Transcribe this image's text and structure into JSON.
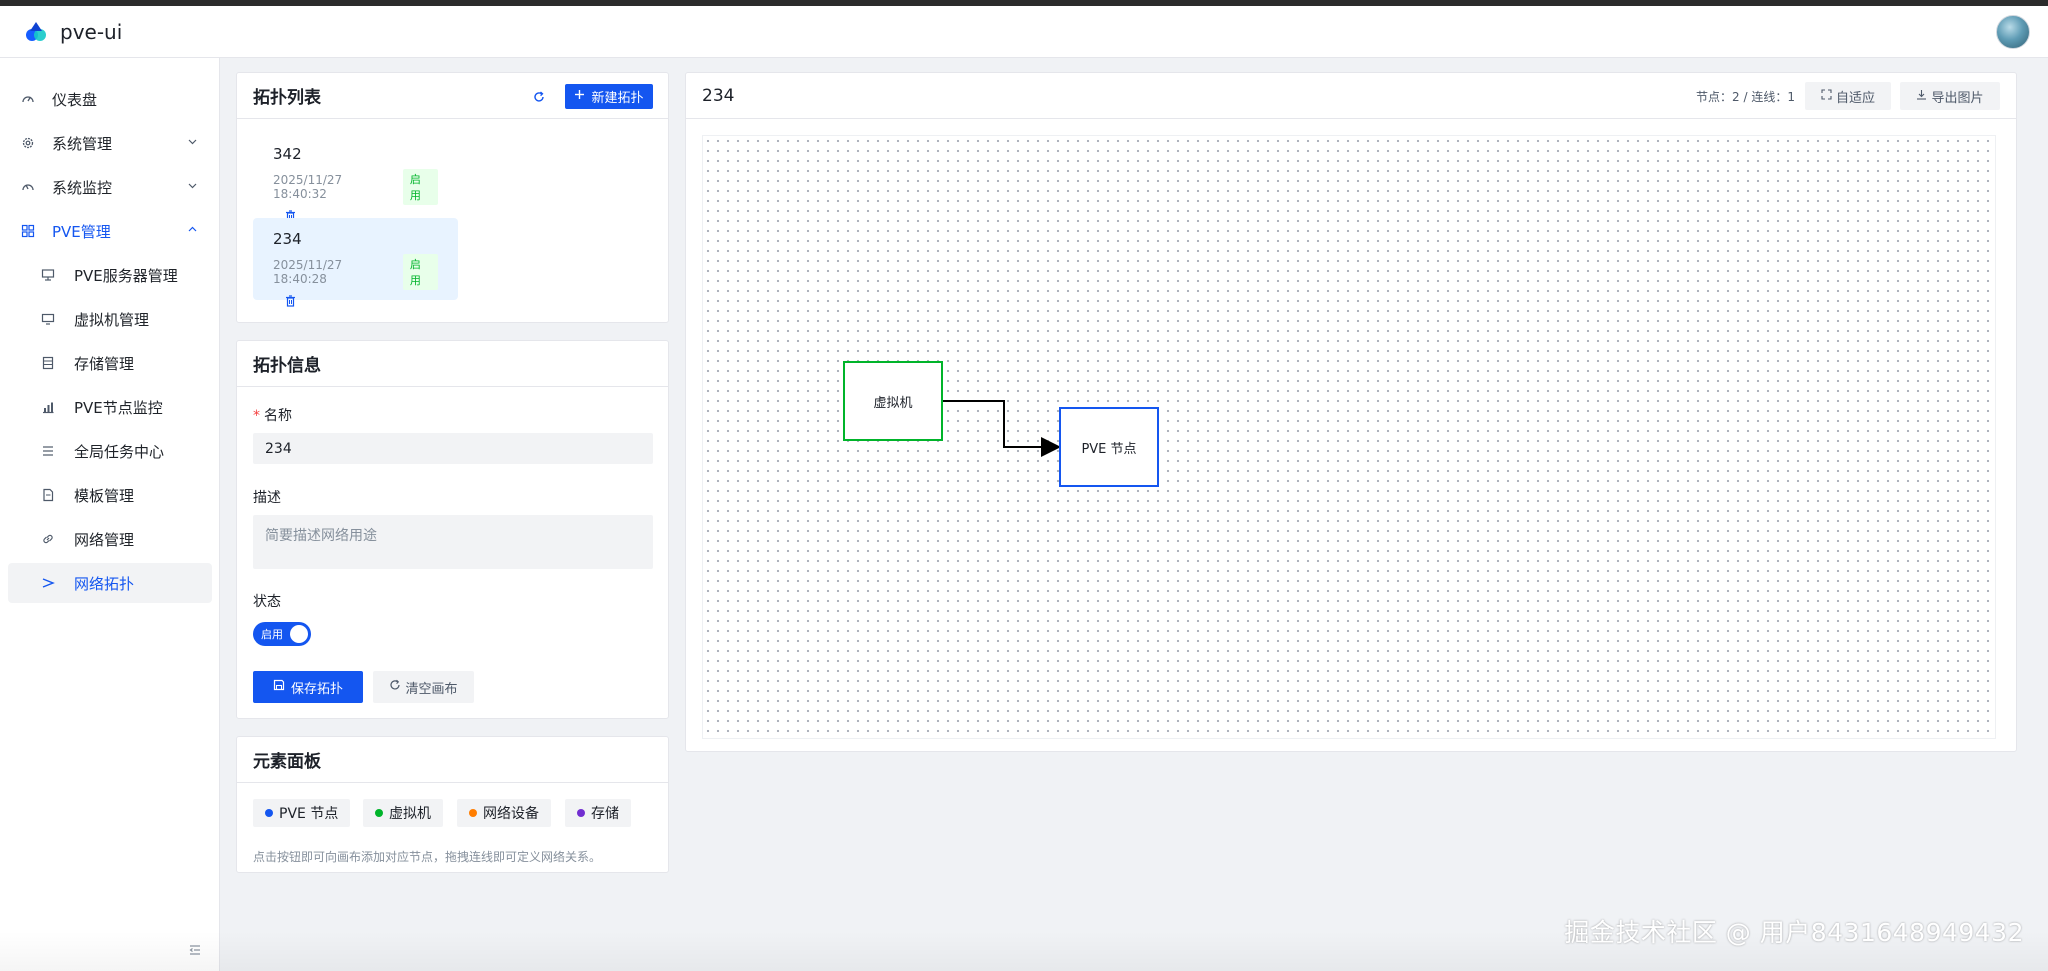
{
  "app": {
    "title": "pve-ui"
  },
  "sidebar": {
    "items": [
      {
        "label": "仪表盘",
        "icon": "dashboard-icon"
      },
      {
        "label": "系统管理",
        "icon": "gear-icon"
      },
      {
        "label": "系统监控",
        "icon": "monitor-icon"
      },
      {
        "label": "PVE管理",
        "icon": "grid-icon"
      },
      {
        "label": "PVE服务器管理",
        "icon": "server-icon"
      },
      {
        "label": "虚拟机管理",
        "icon": "desktop-icon"
      },
      {
        "label": "存储管理",
        "icon": "storage-icon"
      },
      {
        "label": "PVE节点监控",
        "icon": "bar-chart-icon"
      },
      {
        "label": "全局任务中心",
        "icon": "list-icon"
      },
      {
        "label": "模板管理",
        "icon": "file-icon"
      },
      {
        "label": "网络管理",
        "icon": "link-icon"
      },
      {
        "label": "网络拓扑",
        "icon": "topology-icon"
      }
    ]
  },
  "topology_list": {
    "title": "拓扑列表",
    "new_button": "新建拓扑",
    "items": [
      {
        "name": "342",
        "date": "2025/11/27 18:40:32",
        "status": "启用"
      },
      {
        "name": "234",
        "date": "2025/11/27 18:40:28",
        "status": "启用"
      }
    ]
  },
  "topology_info": {
    "title": "拓扑信息",
    "name_label": "名称",
    "name_value": "234",
    "desc_label": "描述",
    "desc_placeholder": "简要描述网络用途",
    "status_label": "状态",
    "switch_text": "启用",
    "save_button": "保存拓扑",
    "clear_button": "清空画布"
  },
  "element_panel": {
    "title": "元素面板",
    "buttons": [
      {
        "label": "PVE 节点",
        "color": "#1456f0"
      },
      {
        "label": "虚拟机",
        "color": "#00b42a"
      },
      {
        "label": "网络设备",
        "color": "#ff7d00"
      },
      {
        "label": "存储",
        "color": "#722ed1"
      }
    ],
    "hint": "点击按钮即可向画布添加对应节点，拖拽连线即可定义网络关系。"
  },
  "canvas": {
    "title": "234",
    "stats": "节点：2 / 连线：1",
    "fit_button": "自适应",
    "export_button": "导出图片",
    "nodes": [
      {
        "label": "虚拟机",
        "color": "#00b42a"
      },
      {
        "label": "PVE 节点",
        "color": "#1456f0"
      }
    ]
  },
  "watermark": "掘金技术社区 @ 用户8431648949432"
}
